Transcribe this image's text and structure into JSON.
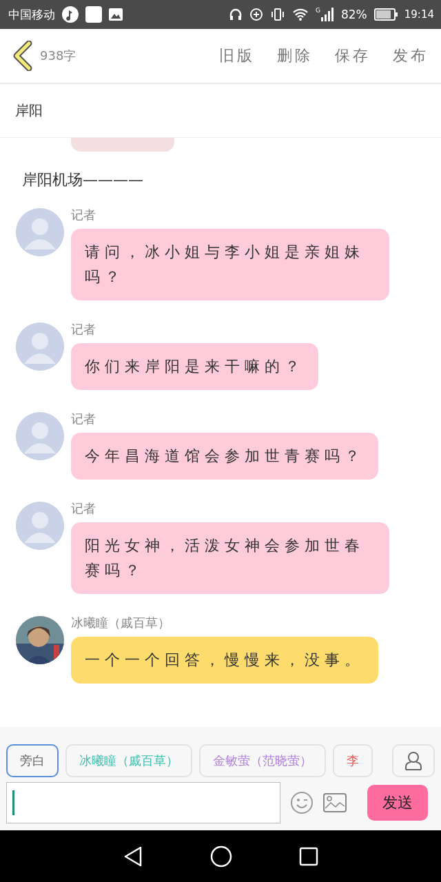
{
  "status_bar": {
    "carrier": "中国移动",
    "network": "G",
    "battery": "82%",
    "time": "19:14"
  },
  "header": {
    "word_count": "938字",
    "actions": [
      "旧版",
      "删除",
      "保存",
      "发布"
    ]
  },
  "title": "岸阳",
  "feed": [
    {
      "kind": "tail",
      "color": "#f3dfe1"
    },
    {
      "kind": "narration",
      "text": "岸阳机场————"
    },
    {
      "kind": "message",
      "photo_avatar": false,
      "sender": "记者",
      "text": "请问，冰小姐与李小姐是亲姐妹吗？",
      "color": "#fdcbd9"
    },
    {
      "kind": "message",
      "photo_avatar": false,
      "sender": "记者",
      "text": "你们来岸阳是来干嘛的？",
      "color": "#fdcbd9"
    },
    {
      "kind": "message",
      "photo_avatar": false,
      "sender": "记者",
      "text": "今年昌海道馆会参加世青赛吗？",
      "color": "#fdcbd9"
    },
    {
      "kind": "message",
      "photo_avatar": false,
      "sender": "记者",
      "text": "阳光女神，活泼女神会参加世春赛吗？",
      "color": "#fdcbd9"
    },
    {
      "kind": "message",
      "photo_avatar": true,
      "sender": "冰曦瞳（戚百草）",
      "text": "一个一个回答，慢慢来，没事。",
      "color": "#fddc6d"
    }
  ],
  "roles": [
    {
      "label": "旁白",
      "color": "#666666",
      "selected": true
    },
    {
      "label": "冰曦瞳（戚百草）",
      "color": "#3cbfae",
      "selected": false
    },
    {
      "label": "金敏萤（范晓萤）",
      "color": "#b07fe0",
      "selected": false
    },
    {
      "label": "李",
      "color": "#e8554e",
      "selected": false
    }
  ],
  "composer": {
    "send": "发送"
  }
}
